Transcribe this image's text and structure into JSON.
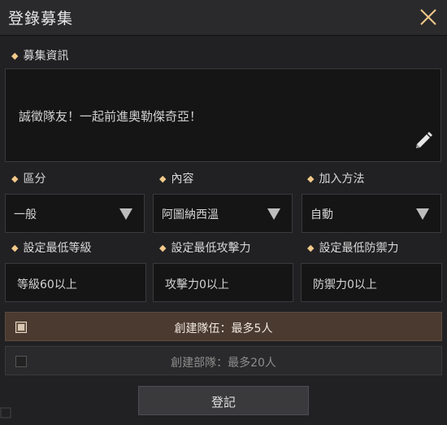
{
  "window": {
    "title": "登錄募集",
    "close_icon": "close-icon"
  },
  "info": {
    "label": "募集資訊",
    "text": "誠徵隊友！一起前進奧勒傑奇亞！",
    "edit_icon": "pencil-icon"
  },
  "filters": [
    {
      "label": "區分",
      "value": "一般"
    },
    {
      "label": "內容",
      "value": "阿圖納西溫"
    },
    {
      "label": "加入方法",
      "value": "自動"
    }
  ],
  "requirements": [
    {
      "label": "設定最低等級",
      "value": "等級60以上"
    },
    {
      "label": "設定最低攻擊力",
      "value": "攻擊力0以上"
    },
    {
      "label": "設定最低防禦力",
      "value": "防禦力0以上"
    }
  ],
  "options": {
    "team": {
      "label": "創建隊伍：最多5人",
      "checked": true
    },
    "squad": {
      "label": "創建部隊：最多20人",
      "checked": false
    }
  },
  "submit_label": "登記",
  "colors": {
    "accent_diamond": "#f2c98a",
    "selected_option_bg": "#4a3a30"
  }
}
